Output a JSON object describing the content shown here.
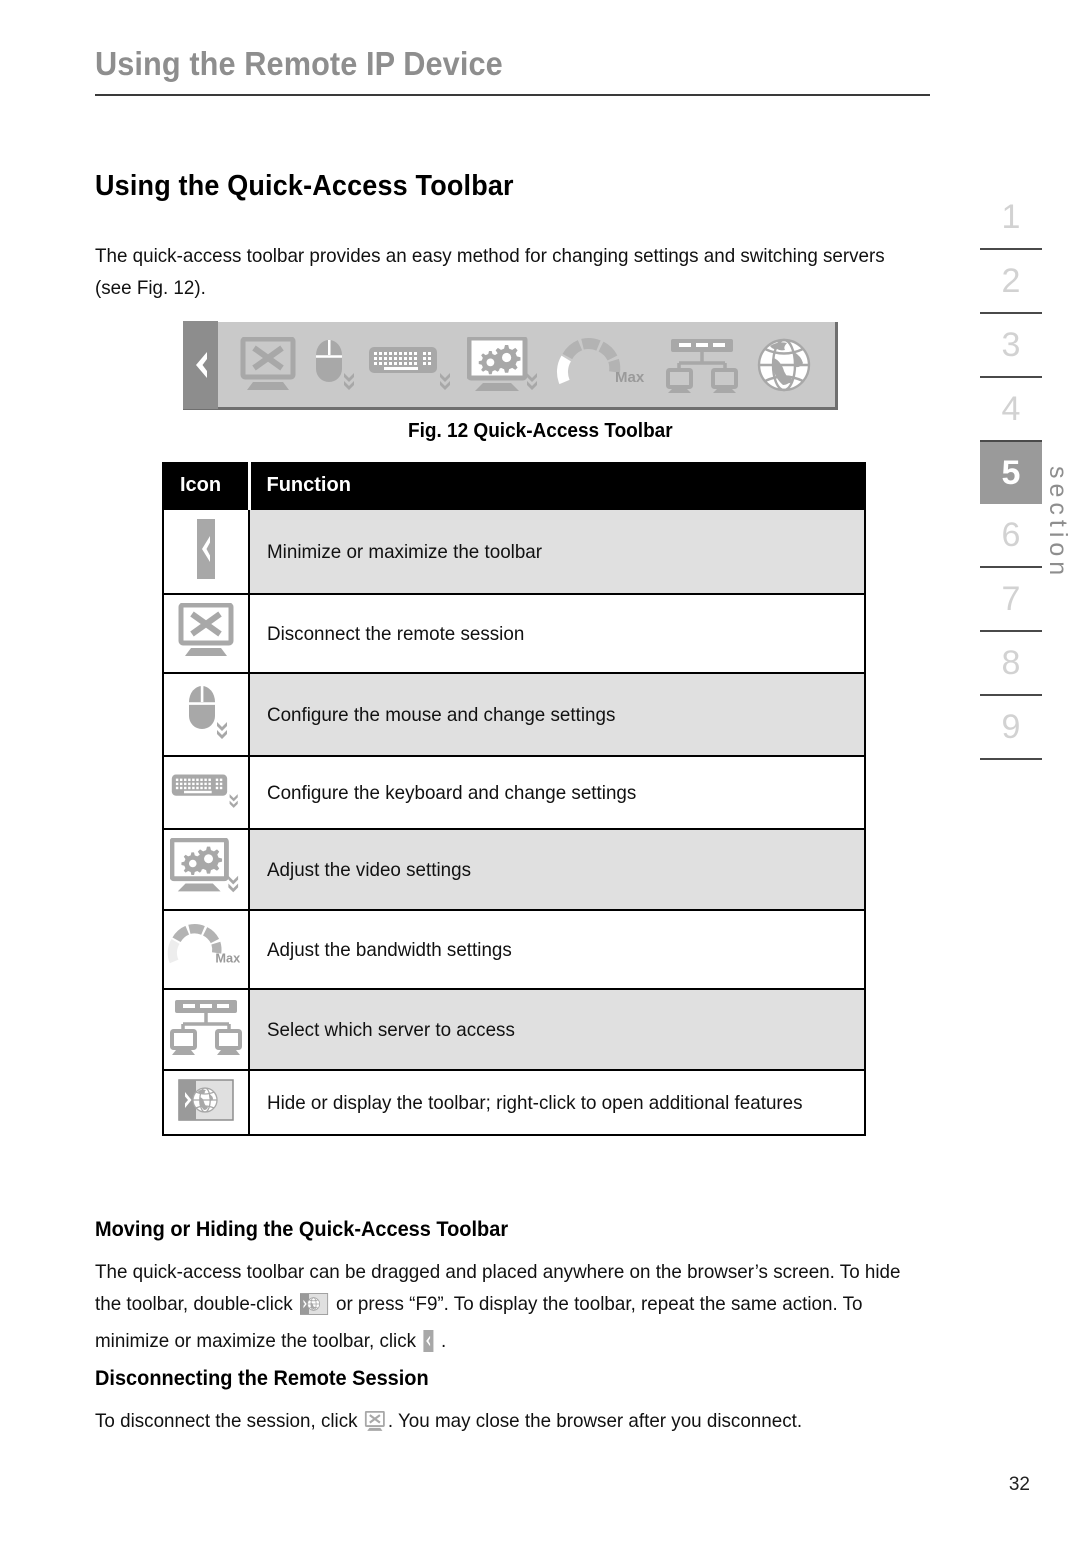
{
  "running_header": {
    "title": "Using the Remote IP Device"
  },
  "heading": {
    "main": "Using the Quick-Access Toolbar"
  },
  "intro": {
    "paragraph": "The quick-access toolbar provides an easy method for changing settings and switching servers (see Fig. 12)."
  },
  "figure": {
    "caption": "Fig. 12 Quick-Access Toolbar",
    "toolbar_items": [
      "minimize-chevron-handle",
      "disconnect-monitor-x-icon",
      "mouse-icon",
      "keyboard-icon",
      "video-gears-monitor-icon",
      "bandwidth-dial-icon",
      "server-select-network-icon",
      "globe-icon"
    ],
    "dial_label": "Max"
  },
  "table": {
    "headers": {
      "icon": "Icon",
      "function": "Function"
    },
    "rows": [
      {
        "icon": "minimize-chevron-handle-icon",
        "function": "Minimize or maximize the toolbar"
      },
      {
        "icon": "disconnect-monitor-x-icon",
        "function": "Disconnect the remote session"
      },
      {
        "icon": "mouse-icon",
        "function": "Configure the mouse and change settings"
      },
      {
        "icon": "keyboard-icon",
        "function": "Configure the keyboard and change settings"
      },
      {
        "icon": "video-gears-monitor-icon",
        "function": "Adjust the video settings"
      },
      {
        "icon": "bandwidth-dial-icon",
        "function": "Adjust the bandwidth settings"
      },
      {
        "icon": "server-select-network-icon",
        "function": "Select which server to access"
      },
      {
        "icon": "hide-display-globe-icon",
        "function": "Hide or display the toolbar; right-click to open additional features"
      }
    ]
  },
  "section_move": {
    "title": "Moving or Hiding the Quick-Access Toolbar",
    "text_1": "The quick-access toolbar can be dragged and placed anywhere on the browser’s screen. To hide the toolbar, double-click ",
    "text_2": " or press “F9”. To display the toolbar, repeat the same action. To minimize or maximize the toolbar, click ",
    "text_3": " ."
  },
  "section_disconnect": {
    "title": "Disconnecting the Remote Session",
    "text_1": "To disconnect the session, click ",
    "text_2": ". You may close the browser after you disconnect."
  },
  "section_rail": {
    "numbers": [
      "1",
      "2",
      "3",
      "4",
      "5",
      "6",
      "7",
      "8",
      "9"
    ],
    "active": "5",
    "label": "section"
  },
  "page_number": "32",
  "colors": {
    "toolbar_body": "#c9c9c9",
    "toolbar_handle": "#8d8d8d",
    "icon_gray": "#a8a8a8",
    "row_shade": "#e0e0e0",
    "header_gray": "#8e8e8e",
    "rail_inactive": "#d2d2d2",
    "rail_active_bg": "#9a9a9a"
  }
}
